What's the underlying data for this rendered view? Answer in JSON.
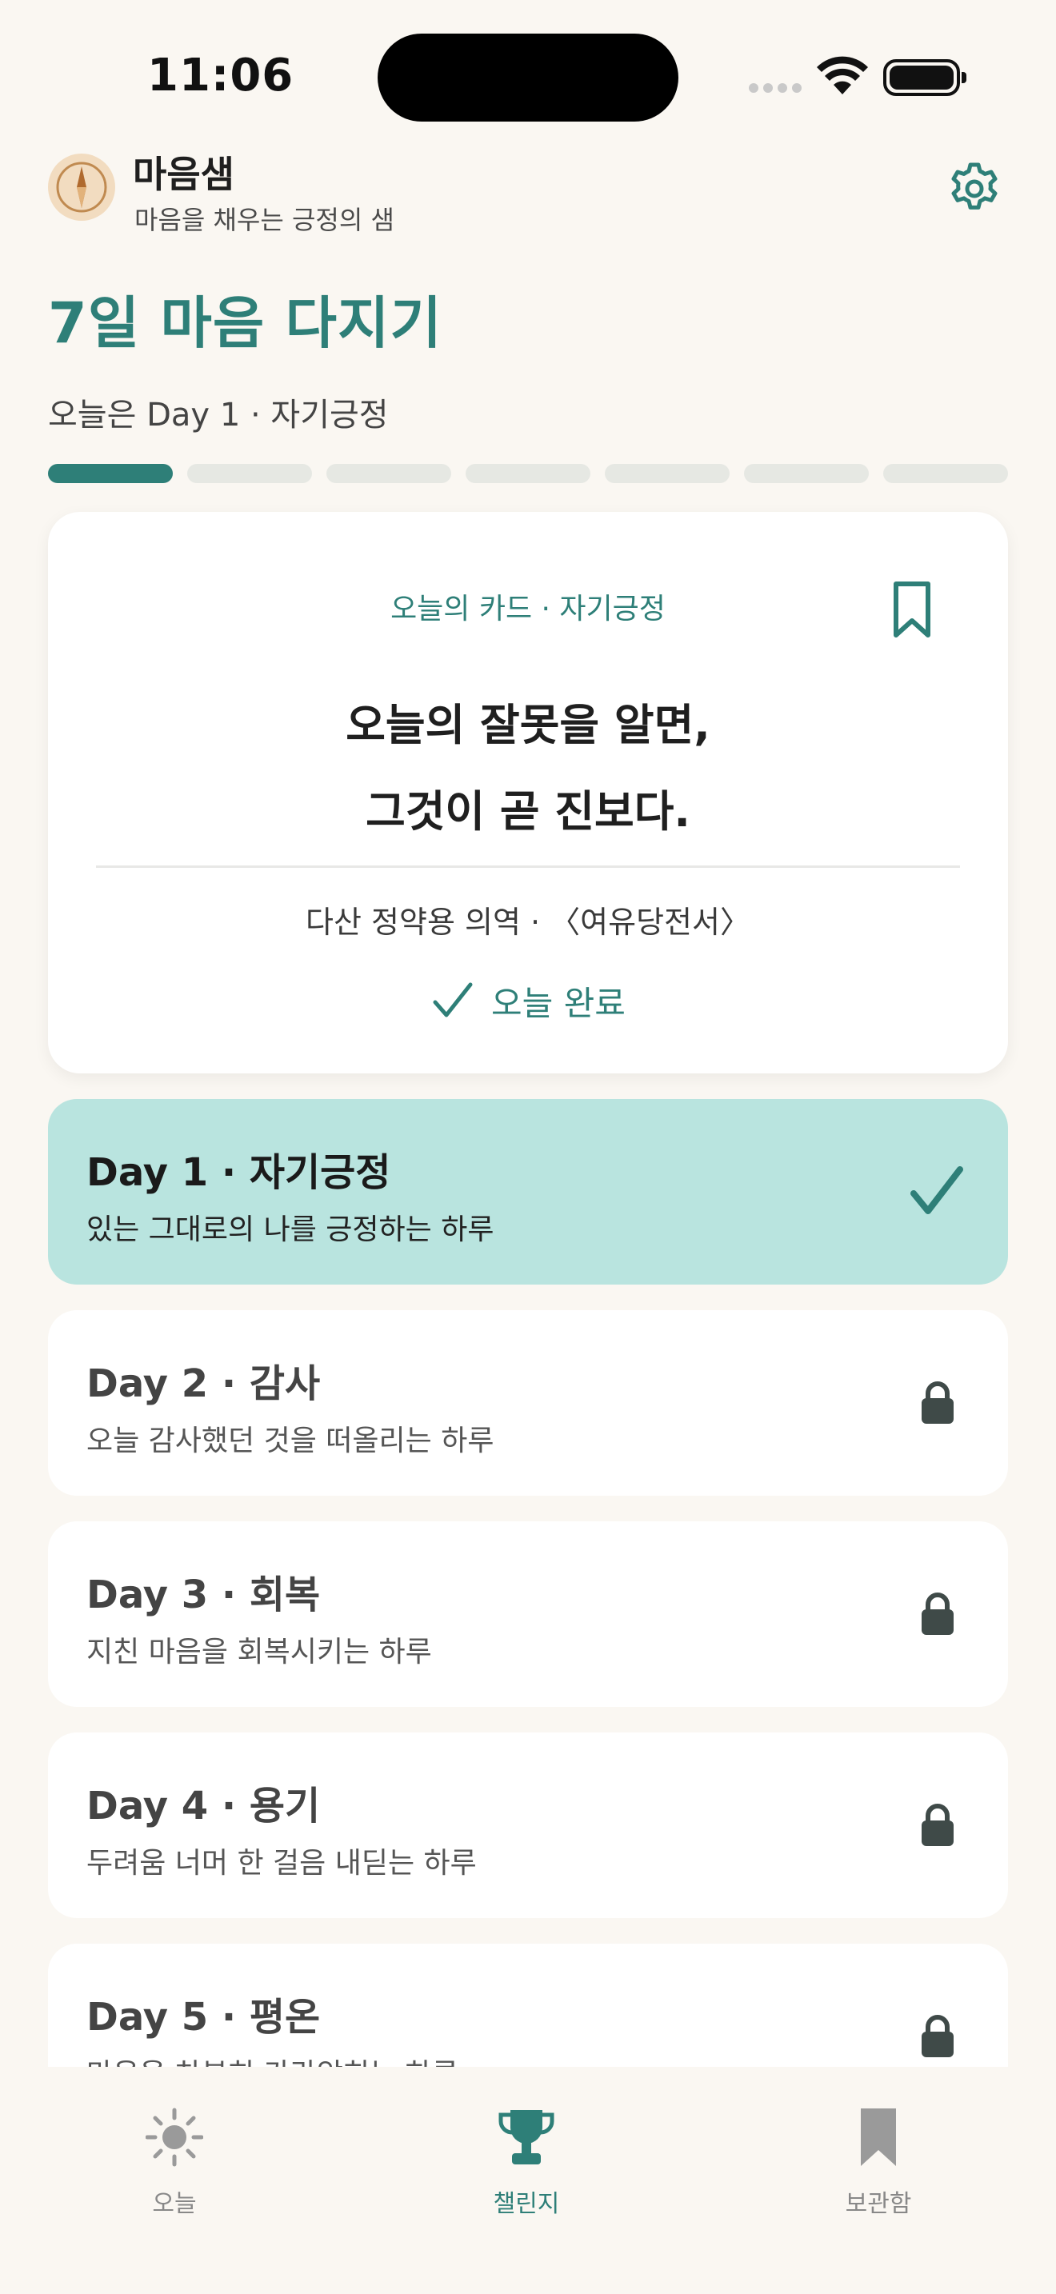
{
  "status_bar": {
    "time": "11:06"
  },
  "header": {
    "app_name": "마음샘",
    "tagline": "마음을 채우는 긍정의 샘"
  },
  "challenge": {
    "title": "7일 마음 다지기",
    "today_label": "오늘은 Day 1 · 자기긍정",
    "progress": {
      "current_day": 1,
      "total_days": 7
    }
  },
  "quote_card": {
    "label": "오늘의 카드 · 자기긍정",
    "quote_lines": [
      "오늘의 잘못을 알면,",
      "그것이 곧 진보다."
    ],
    "source": "다산 정약용 의역 · 〈여유당전서〉",
    "done_label": "오늘 완료"
  },
  "days": [
    {
      "title": "Day 1 · 자기긍정",
      "desc": "있는 그대로의 나를 긍정하는 하루",
      "status": "done"
    },
    {
      "title": "Day 2 · 감사",
      "desc": "오늘 감사했던 것을 떠올리는 하루",
      "status": "locked"
    },
    {
      "title": "Day 3 · 회복",
      "desc": "지친 마음을 회복시키는 하루",
      "status": "locked"
    },
    {
      "title": "Day 4 · 용기",
      "desc": "두려움 너머 한 걸음 내딛는 하루",
      "status": "locked"
    },
    {
      "title": "Day 5 · 평온",
      "desc": "마음을 차분히 가라앉히는 하루",
      "status": "locked"
    }
  ],
  "tabs": [
    {
      "label": "오늘",
      "icon": "sun-icon",
      "active": false
    },
    {
      "label": "챌린지",
      "icon": "trophy-icon",
      "active": true
    },
    {
      "label": "보관함",
      "icon": "bookmark-icon",
      "active": false
    }
  ],
  "colors": {
    "accent": "#2e7f78",
    "active_day_bg": "#b9e4df",
    "background": "#faf7f2"
  }
}
